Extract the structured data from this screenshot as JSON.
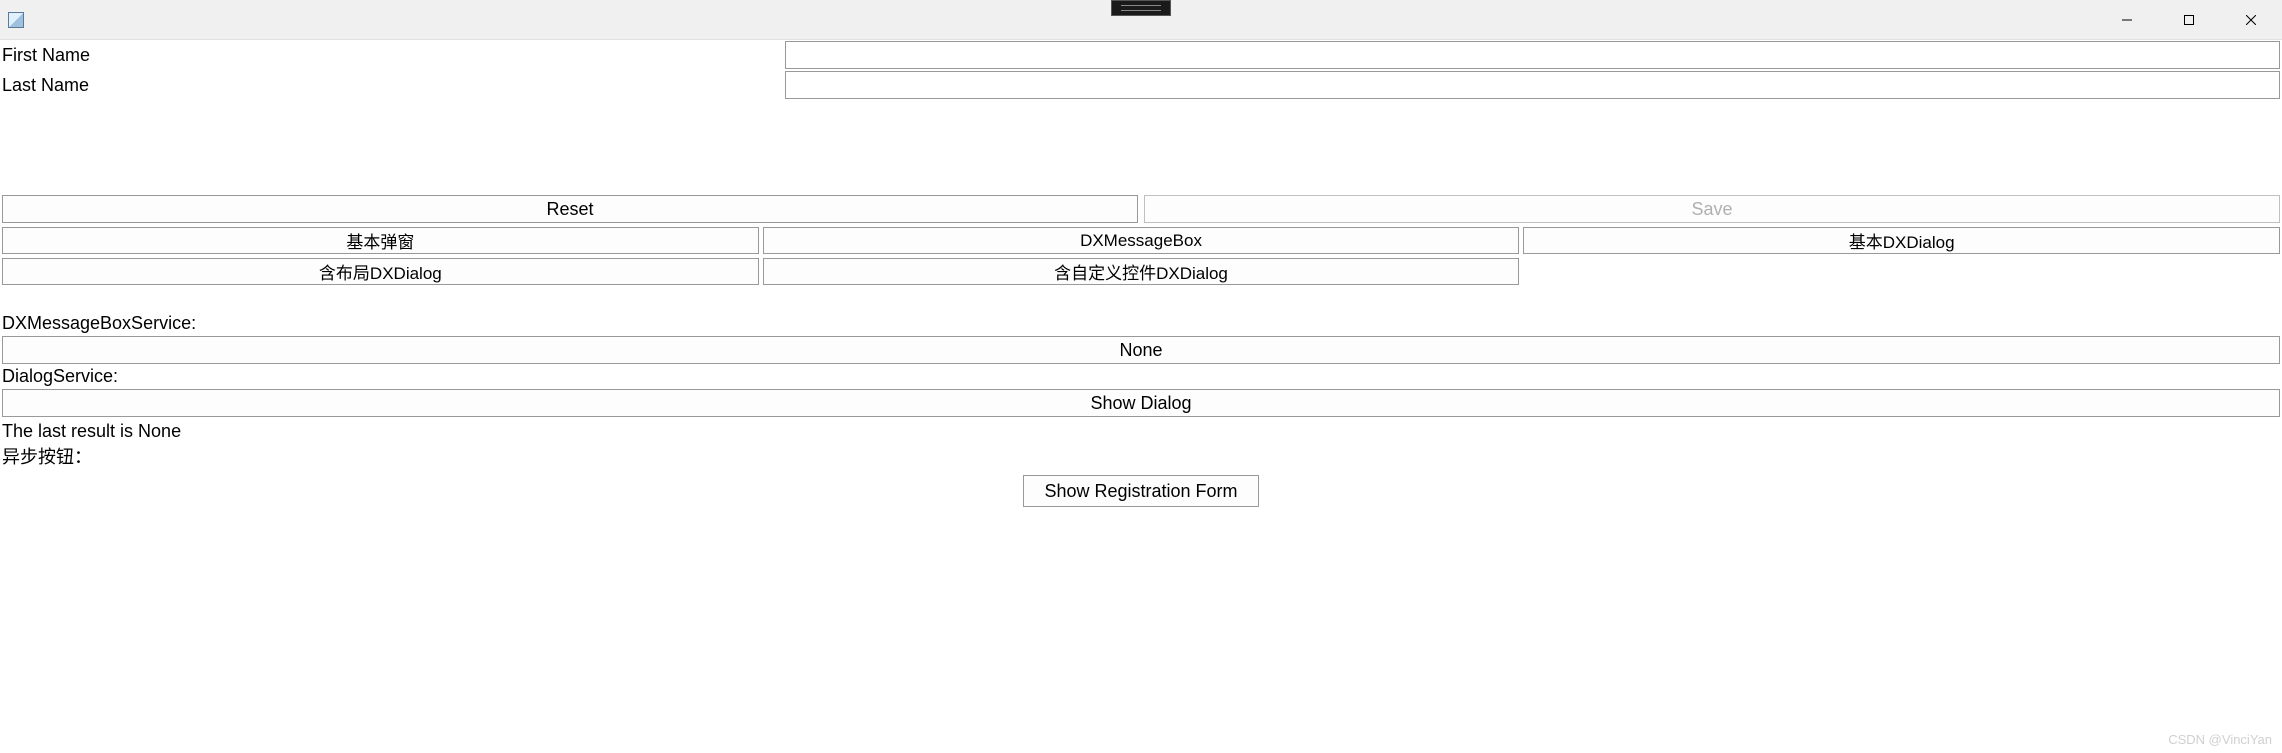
{
  "titlebar": {
    "title": ""
  },
  "form": {
    "first_name_label": "First Name",
    "first_name_value": "",
    "last_name_label": "Last Name",
    "last_name_value": ""
  },
  "buttons": {
    "reset": "Reset",
    "save": "Save",
    "basic_popup": "基本弹窗",
    "dx_messagebox": "DXMessageBox",
    "basic_dxdialog": "基本DXDialog",
    "layout_dxdialog": "含布局DXDialog",
    "custom_dxdialog": "含自定义控件DXDialog",
    "none": "None",
    "show_dialog": "Show Dialog",
    "show_registration": "Show Registration Form"
  },
  "labels": {
    "dx_messagebox_service": "DXMessageBoxService:",
    "dialog_service": "DialogService:",
    "last_result": "The last result is None",
    "async_button": "异步按钮："
  },
  "watermark": "CSDN @VinciYan"
}
